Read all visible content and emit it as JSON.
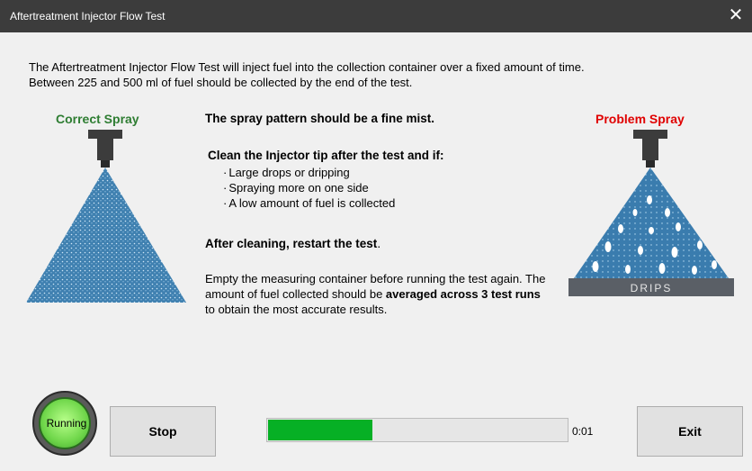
{
  "window": {
    "title": "Aftertreatment Injector Flow Test",
    "close_glyph": "✕"
  },
  "intro": {
    "line1": "The Aftertreatment Injector Flow Test will inject fuel into the collection container over a fixed amount of time.",
    "line2": "Between 225 and 500 ml of fuel should be collected by the end of the test."
  },
  "labels": {
    "correct": "Correct Spray",
    "problem": "Problem Spray",
    "drips": "DRIPS"
  },
  "instructions": {
    "pattern": "The spray pattern should be a fine mist.",
    "clean_heading": "Clean the Injector tip after the test and if:",
    "bullets": [
      "Large drops or dripping",
      "Spraying more on one side",
      "A low amount of fuel is collected"
    ],
    "restart_bold": "After cleaning, restart the test",
    "restart_end": ".",
    "para_a": "Empty the measuring container before running the test again. The amount of fuel collected should be ",
    "para_bold": "averaged across 3 test runs",
    "para_b": " to obtain the most accurate results."
  },
  "status": {
    "label": "Running",
    "color": "#6fd64a"
  },
  "buttons": {
    "stop": "Stop",
    "exit": "Exit"
  },
  "progress": {
    "fraction": 0.35,
    "time": "0:01",
    "color": "#06b025"
  }
}
